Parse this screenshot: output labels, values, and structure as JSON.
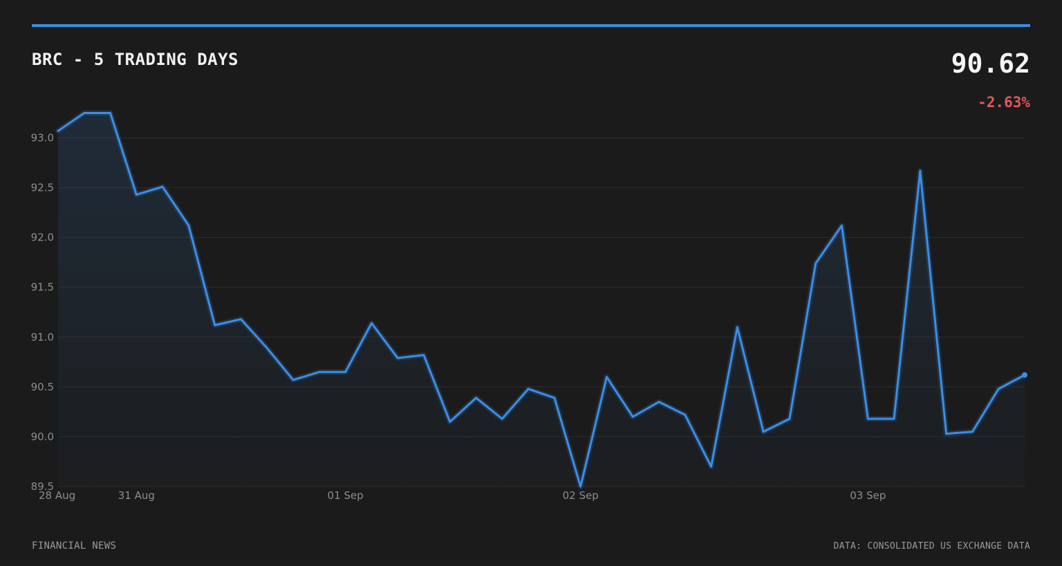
{
  "header": {
    "title": "BRC - 5 TRADING DAYS",
    "price": "90.62",
    "change": "-2.63%"
  },
  "footer": {
    "source_left": "FINANCIAL NEWS",
    "source_right": "DATA: CONSOLIDATED US EXCHANGE DATA"
  },
  "colors": {
    "accent": "#3b8ee8",
    "line": "#3b8ee8",
    "negative": "#e05a5a",
    "grid": "#2c2c2c",
    "background": "#1b1b1b"
  },
  "chart_data": {
    "type": "area",
    "title": "BRC - 5 TRADING DAYS",
    "ylim": [
      89.5,
      93.25
    ],
    "yticks": [
      "89.5",
      "90.0",
      "90.5",
      "91.0",
      "91.5",
      "92.0",
      "92.5",
      "93.0"
    ],
    "grid": true,
    "xtick_labels": [
      {
        "label": "28 Aug",
        "index": 0
      },
      {
        "label": "31 Aug",
        "index": 3
      },
      {
        "label": "01 Sep",
        "index": 11
      },
      {
        "label": "02 Sep",
        "index": 20
      },
      {
        "label": "03 Sep",
        "index": 31
      }
    ],
    "series": [
      {
        "values": [
          93.07,
          93.25,
          93.25,
          92.43,
          92.51,
          92.12,
          91.12,
          91.18,
          90.89,
          90.57,
          90.65,
          90.65,
          91.14,
          90.79,
          90.82,
          90.15,
          90.39,
          90.18,
          90.48,
          90.39,
          89.5,
          90.6,
          90.2,
          90.35,
          90.22,
          89.7,
          91.1,
          90.05,
          90.18,
          91.74,
          92.12,
          90.18,
          90.18,
          92.67,
          90.03,
          90.05,
          90.48,
          90.62
        ]
      }
    ]
  }
}
